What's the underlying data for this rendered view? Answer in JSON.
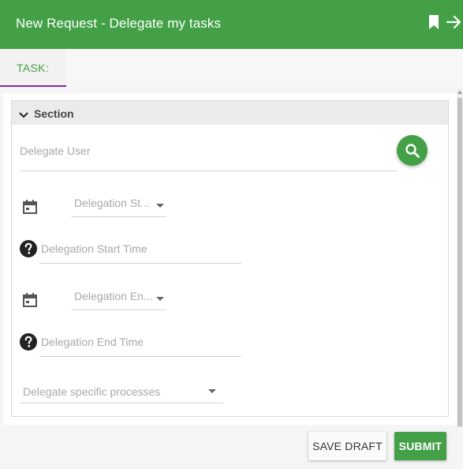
{
  "header": {
    "title": "New Request - Delegate my tasks",
    "icons": [
      "bookmark-icon",
      "arrow-right-icon"
    ]
  },
  "tabs": [
    {
      "label": "TASK:",
      "active": true
    }
  ],
  "section": {
    "title": "Section",
    "expanded": true,
    "fields": {
      "delegate_user": {
        "placeholder": "Delegate User"
      },
      "start_date": {
        "placeholder": "Delegation St..."
      },
      "start_time": {
        "placeholder": "Delegation Start Time"
      },
      "end_date": {
        "placeholder": "Delegation En..."
      },
      "end_time": {
        "placeholder": "Delegation End Time"
      },
      "processes": {
        "placeholder": "Delegate specific processes"
      }
    }
  },
  "actions": {
    "save_draft": "SAVE DRAFT",
    "submit": "SUBMIT"
  },
  "colors": {
    "primary": "#43a047",
    "tab_indicator": "#8e24aa"
  }
}
